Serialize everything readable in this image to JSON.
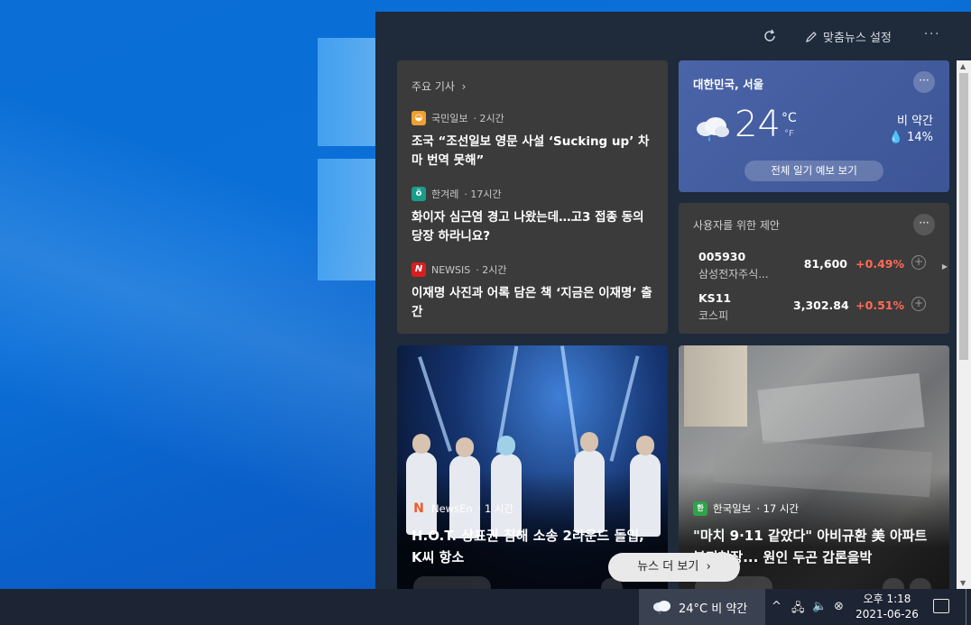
{
  "colors": {
    "panel_bg": "#1f2a3a",
    "card_bg": "#3b3b3b",
    "weather_bg": "#4a64a8",
    "positive_change": "#ff6b57",
    "taskbar_bg": "#1d2433"
  },
  "header": {
    "refresh_icon": "refresh-icon",
    "settings_label": "맞춤뉴스 설정",
    "more_label": "···"
  },
  "top_stories": {
    "title": "주요 기사",
    "items": [
      {
        "source": "국민일보",
        "time": "· 2시간",
        "title": "조국 “조선일보 영문 사설 ‘Sucking up’ 차마 번역 못해”"
      },
      {
        "source": "한겨레",
        "time": "· 17시간",
        "title": "화이자 심근염 경고 나왔는데…고3 접종 동의 당장 하라니요?"
      },
      {
        "source": "NEWSIS",
        "time": "· 2시간",
        "title": "이재명 사진과 어록 담은 책 ‘지금은 이재명’ 출간"
      }
    ]
  },
  "weather": {
    "location": "대한민국, 서울",
    "temp": "24",
    "unit_c": "°C",
    "unit_f": "°F",
    "condition": "비 약간",
    "precip": "14%",
    "forecast_button": "전체 일기 예보 보기"
  },
  "stocks": {
    "title": "사용자를 위한 제안",
    "items": [
      {
        "symbol": "005930",
        "name": "삼성전자주식...",
        "price": "81,600",
        "change": "+0.49%"
      },
      {
        "symbol": "KS11",
        "name": "코스피",
        "price": "3,302.84",
        "change": "+0.51%"
      }
    ]
  },
  "image_cards": [
    {
      "source": "NewsEn",
      "time": "· 1 시간",
      "title": "H.O.T. 상표권 침해 소송 2라운드 돌입, K씨 항소"
    },
    {
      "source": "한국일보",
      "time": "· 17 시간",
      "title": "\"마치 9·11 같았다\" 아비규환 美 아파트 붕괴현장... 원인 두곤 갑론을박"
    }
  ],
  "more_news": "뉴스 더 보기",
  "taskbar": {
    "weather": "24°C  비 약간",
    "time": "오후 1:18",
    "date": "2021-06-26"
  }
}
